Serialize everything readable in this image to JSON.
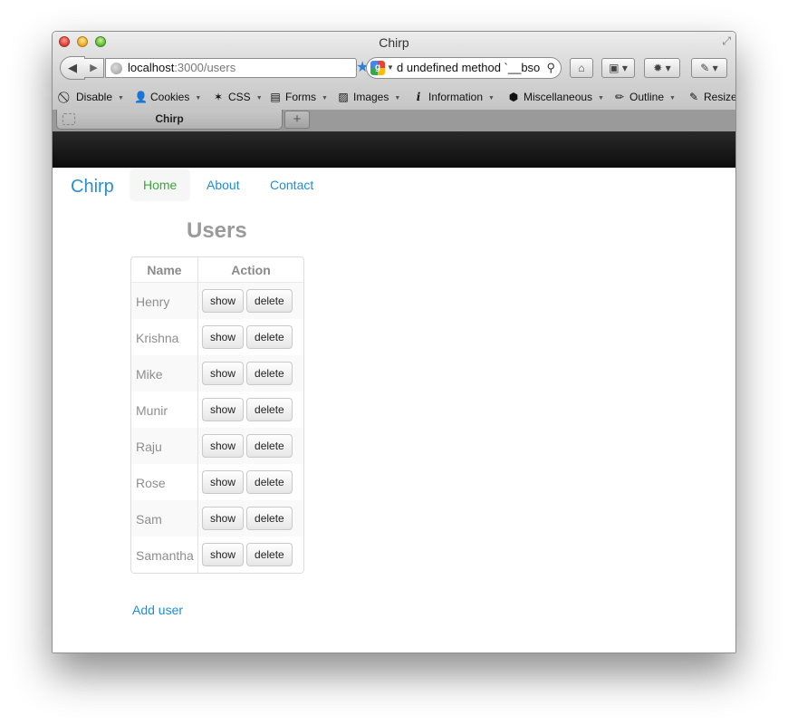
{
  "window": {
    "title": "Chirp"
  },
  "browser": {
    "url_host": "localhost",
    "url_rest": ":3000/users",
    "search_text": "d undefined method `__bso",
    "tab_title": "Chirp",
    "new_tab": "+"
  },
  "web_developer_toolbar": {
    "items": [
      {
        "label": "Disable",
        "icon": "disable-icon"
      },
      {
        "label": "Cookies",
        "icon": "cookies-icon"
      },
      {
        "label": "CSS",
        "icon": "css-icon"
      },
      {
        "label": "Forms",
        "icon": "forms-icon"
      },
      {
        "label": "Images",
        "icon": "images-icon"
      },
      {
        "label": "Information",
        "icon": "information-icon"
      },
      {
        "label": "Miscellaneous",
        "icon": "miscellaneous-icon"
      },
      {
        "label": "Outline",
        "icon": "outline-icon"
      },
      {
        "label": "Resize",
        "icon": "resize-icon"
      }
    ]
  },
  "site": {
    "brand": "Chirp",
    "nav": [
      {
        "label": "Home",
        "active": true
      },
      {
        "label": "About",
        "active": false
      },
      {
        "label": "Contact",
        "active": false
      }
    ]
  },
  "users_page": {
    "title": "Users",
    "columns": [
      "Name",
      "Action"
    ],
    "show_label": "show",
    "delete_label": "delete",
    "users": [
      "Henry",
      "Krishna",
      "Mike",
      "Munir",
      "Raju",
      "Rose",
      "Sam",
      "Samantha"
    ],
    "add_user_label": "Add user"
  },
  "colors": {
    "link": "#1e8ed6",
    "active_nav": "#3aa63a",
    "topbar": "#111111",
    "muted_text": "#9a9a9a"
  }
}
